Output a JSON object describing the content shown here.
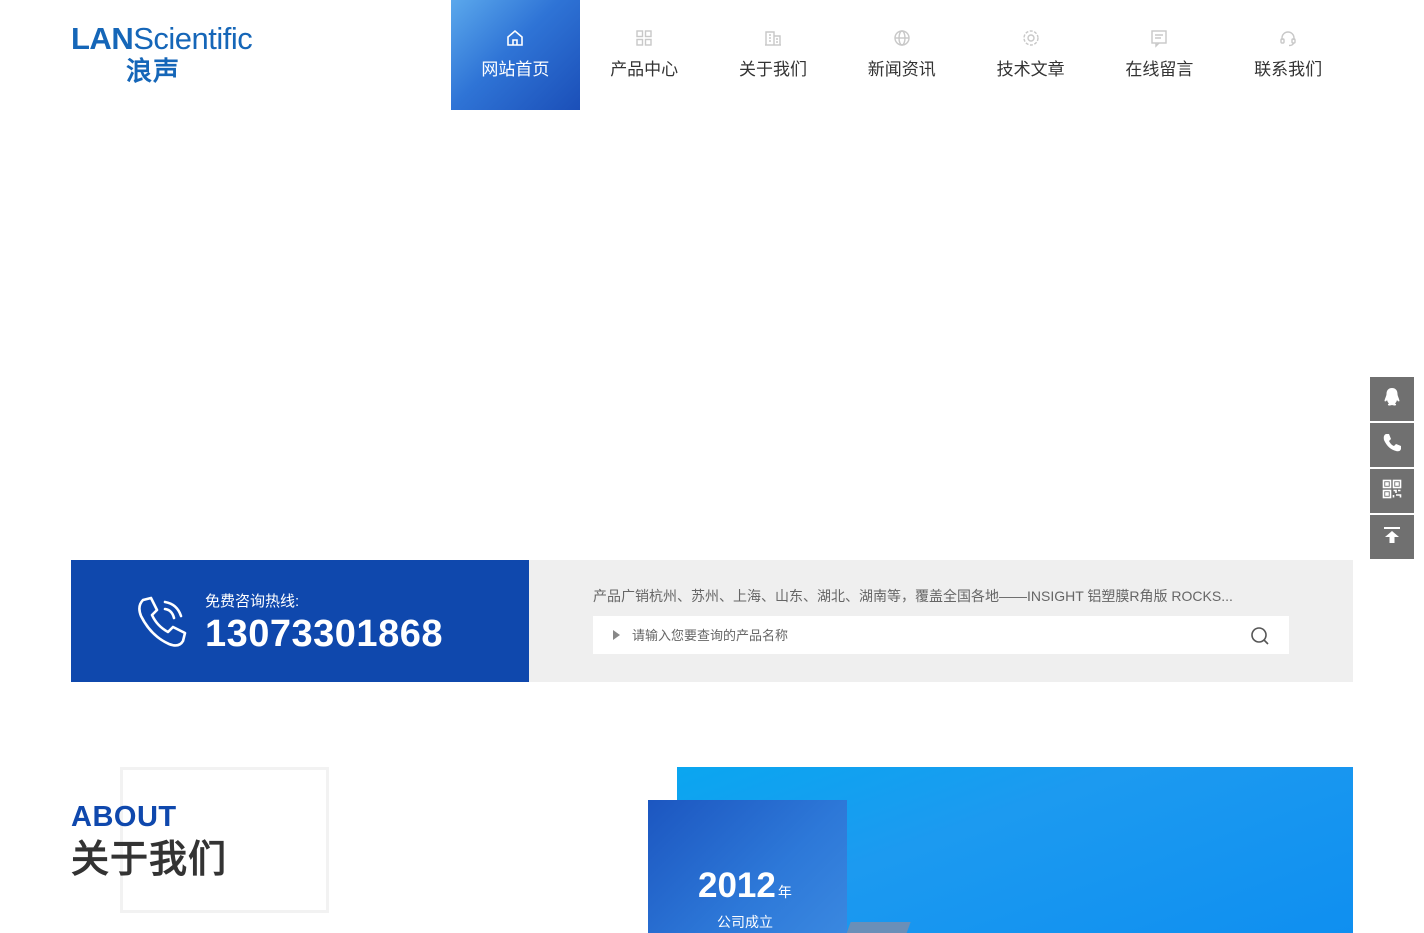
{
  "logo": {
    "en_bold": "LAN",
    "en_light": "Scientific",
    "cn": "浪声"
  },
  "nav": {
    "items": [
      {
        "label": "网站首页",
        "icon": "home-icon",
        "active": true
      },
      {
        "label": "产品中心",
        "icon": "grid-icon",
        "active": false
      },
      {
        "label": "关于我们",
        "icon": "building-icon",
        "active": false
      },
      {
        "label": "新闻资讯",
        "icon": "globe-icon",
        "active": false
      },
      {
        "label": "技术文章",
        "icon": "gear-icon",
        "active": false
      },
      {
        "label": "在线留言",
        "icon": "message-icon",
        "active": false
      },
      {
        "label": "联系我们",
        "icon": "headset-icon",
        "active": false
      }
    ]
  },
  "hotline": {
    "label": "免费咨询热线:",
    "number": "13073301868"
  },
  "search": {
    "hot_words": "产品广销杭州、苏州、上海、山东、湖北、湖南等，覆盖全国各地——INSIGHT 铝塑膜R角版  ROCKS...",
    "placeholder": "请输入您要查询的产品名称"
  },
  "side_toolbar": [
    "qq-icon",
    "phone-icon",
    "qrcode-icon",
    "back-to-top-icon"
  ],
  "about": {
    "title_en": "ABOUT",
    "title_cn": "关于我们",
    "year": "2012",
    "year_unit": "年",
    "year_caption": "公司成立"
  },
  "colors": {
    "brand": "#0f48ad",
    "logo": "#1566b8",
    "side_btn": "#707070",
    "search_bg": "#efefef"
  }
}
